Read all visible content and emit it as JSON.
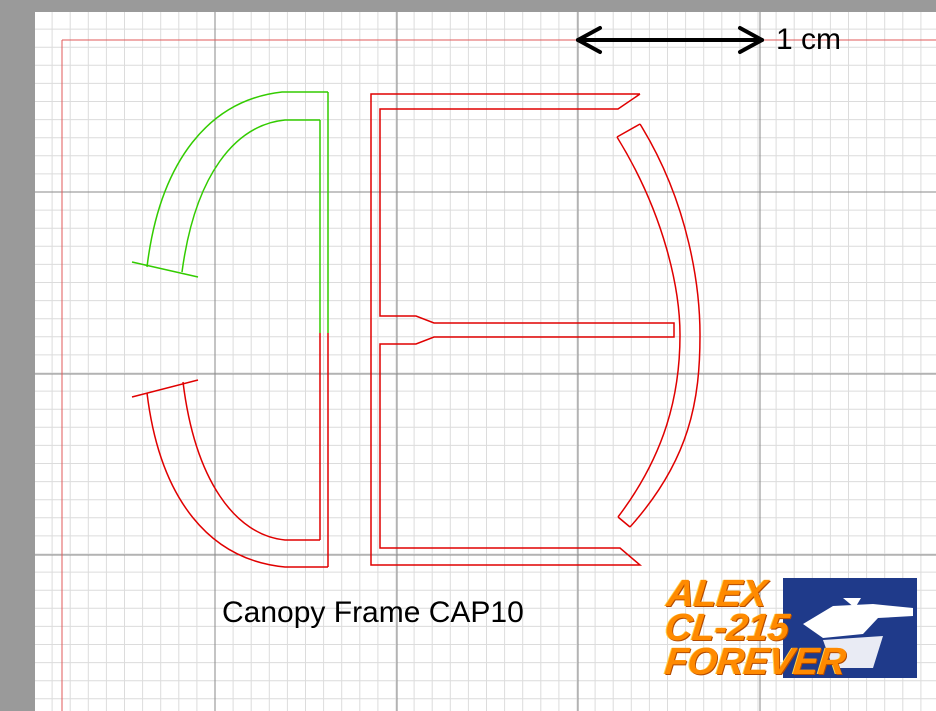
{
  "scale_bar": {
    "label": "1 cm"
  },
  "caption": "Canopy Frame CAP10",
  "logo": {
    "lines": [
      "ALEX",
      "CL-215",
      "FOREVER"
    ]
  },
  "colors": {
    "background": "#9a9a9a",
    "sheet": "#ffffff",
    "grid_minor": "#dcdcdc",
    "grid_major": "#8a8a8a",
    "margin_line": "#e05a5a",
    "green_part": "#33cc00",
    "red_part": "#e00000",
    "logo_orange": "#ff8a00",
    "logo_blue": "#1f3a8a"
  }
}
